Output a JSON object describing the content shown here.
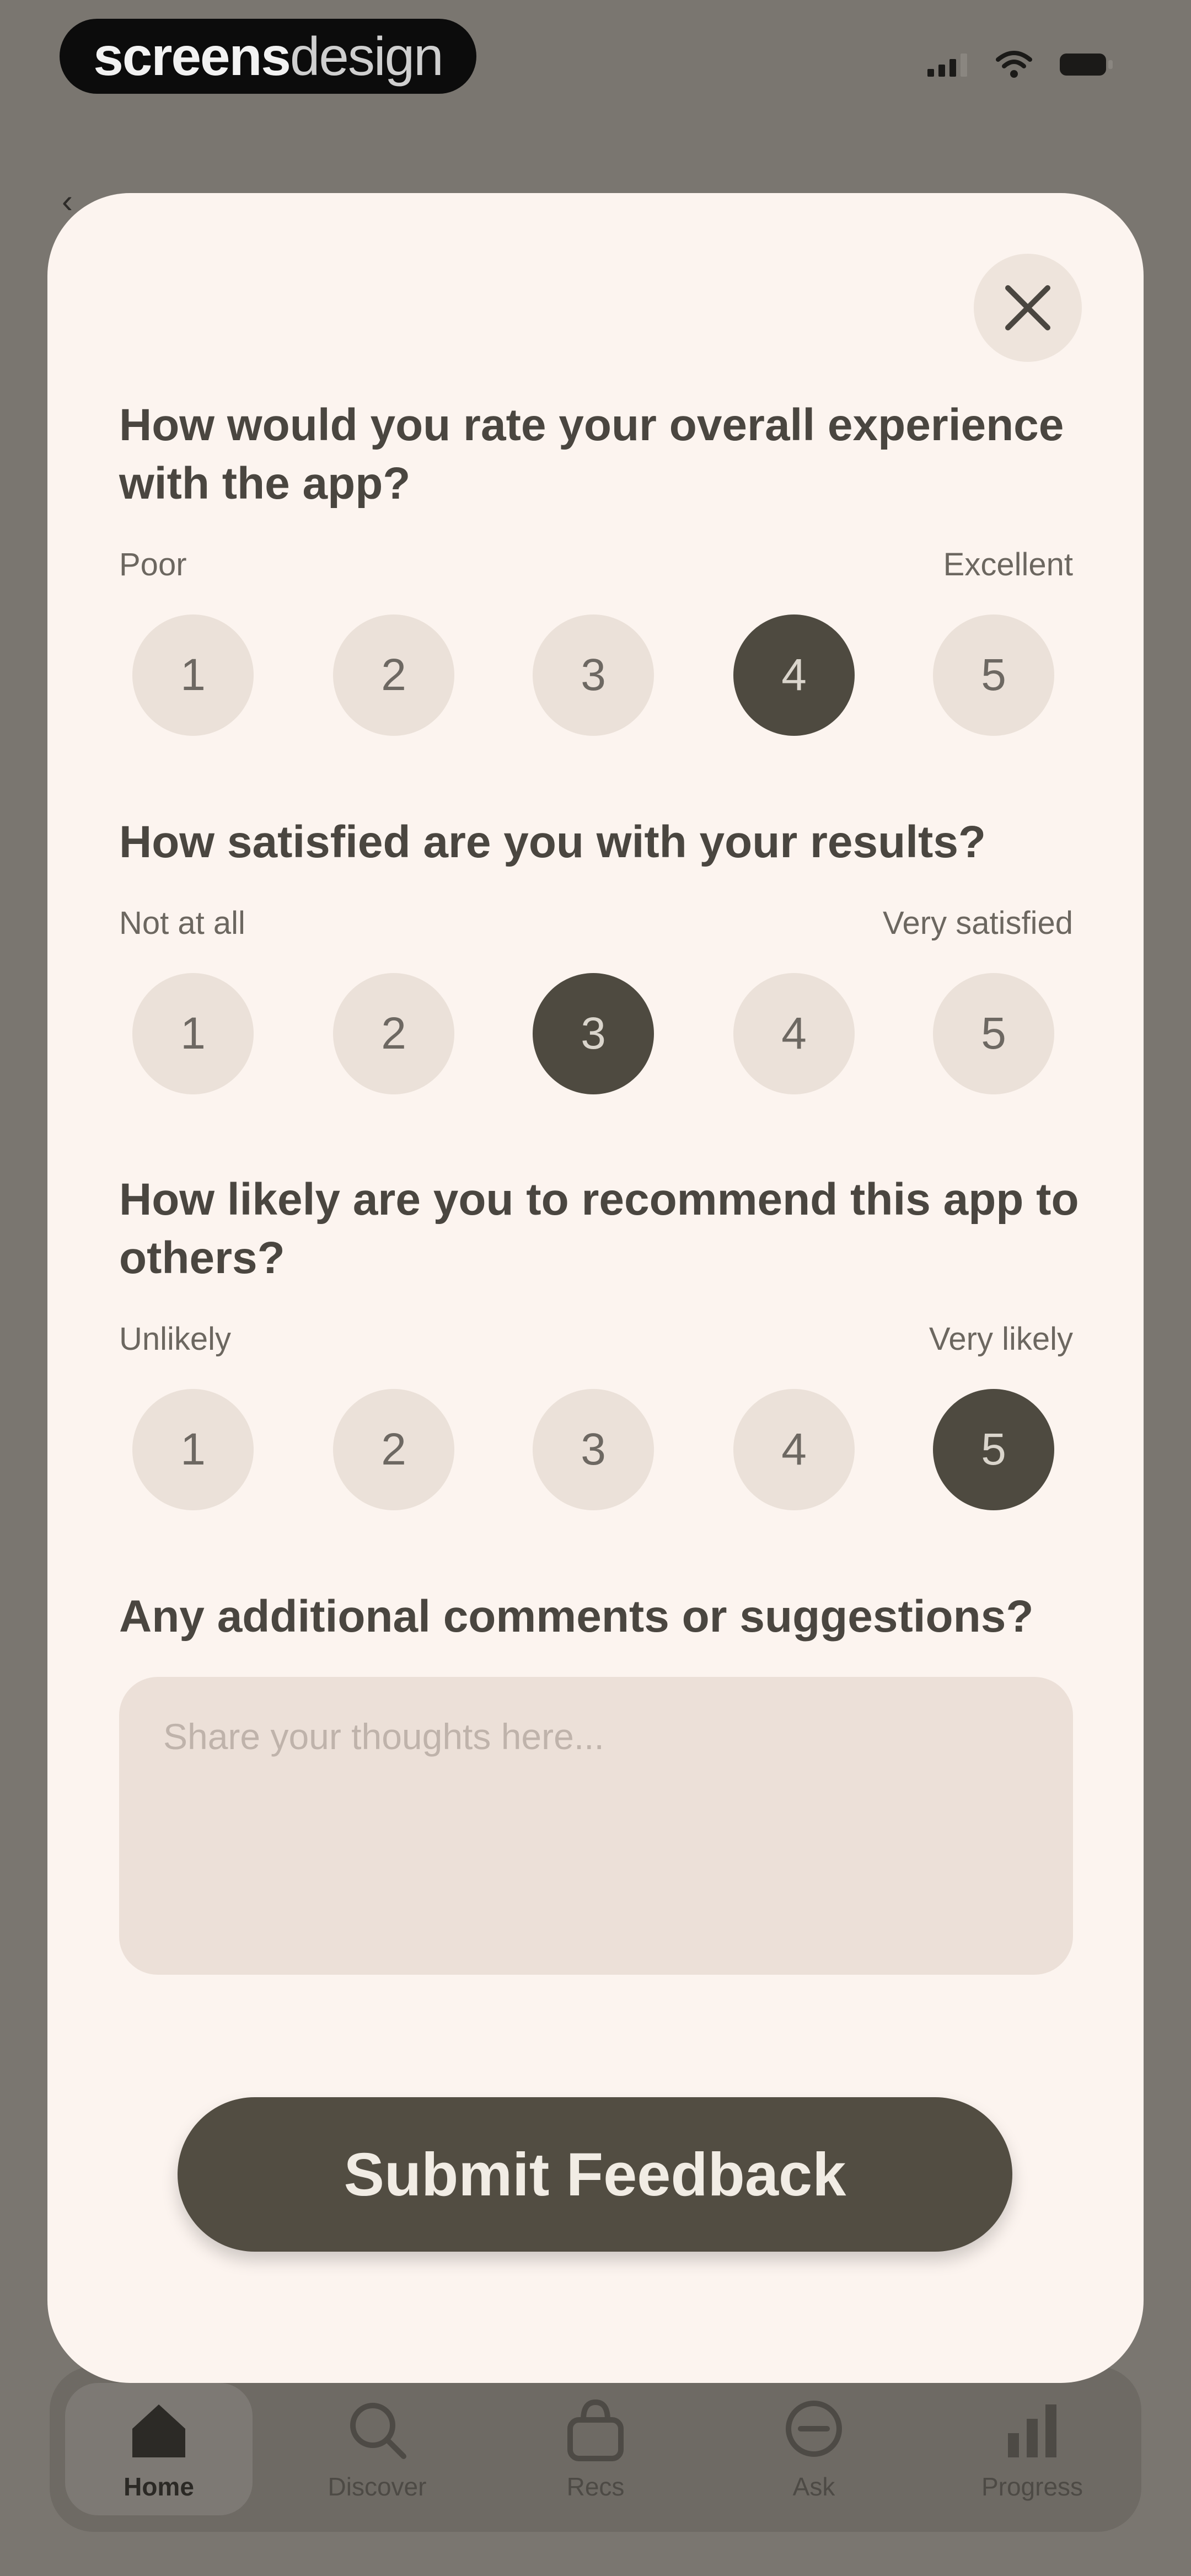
{
  "brand": {
    "bold": "screens",
    "light": "design"
  },
  "survey": {
    "questions": [
      {
        "text": "How would you rate your overall experience with the app?",
        "low_label": "Poor",
        "high_label": "Excellent",
        "options": [
          "1",
          "2",
          "3",
          "4",
          "5"
        ],
        "selected": "4"
      },
      {
        "text": "How satisfied are you with your results?",
        "low_label": "Not at all",
        "high_label": "Very satisfied",
        "options": [
          "1",
          "2",
          "3",
          "4",
          "5"
        ],
        "selected": "3"
      },
      {
        "text": "How likely are you to recommend this app to others?",
        "low_label": "Unlikely",
        "high_label": "Very likely",
        "options": [
          "1",
          "2",
          "3",
          "4",
          "5"
        ],
        "selected": "5"
      }
    ],
    "comments": {
      "label": "Any additional comments or suggestions?",
      "placeholder": "Share your thoughts here...",
      "value": ""
    },
    "submit_label": "Submit Feedback"
  },
  "nav": {
    "items": [
      {
        "label": "Home",
        "icon": "home-icon",
        "active": true
      },
      {
        "label": "Discover",
        "icon": "search-icon",
        "active": false
      },
      {
        "label": "Recs",
        "icon": "bag-icon",
        "active": false
      },
      {
        "label": "Ask",
        "icon": "chat-icon",
        "active": false
      },
      {
        "label": "Progress",
        "icon": "chart-icon",
        "active": false
      }
    ]
  }
}
